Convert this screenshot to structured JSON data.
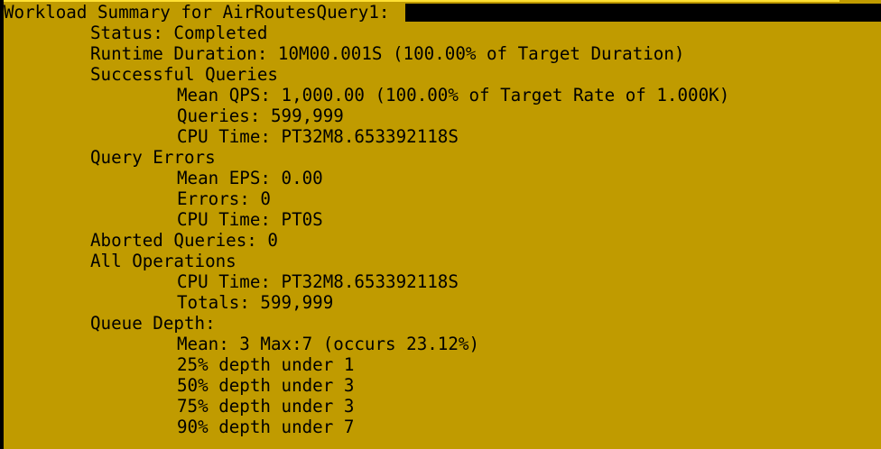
{
  "colors": {
    "background": "#c09b00",
    "text": "#000000",
    "cursor": "#000000",
    "highlight": "#ffe033"
  },
  "summary": {
    "header": "Workload Summary for AirRoutesQuery1:",
    "status": "Status: Completed",
    "runtime": "Runtime Duration: 10M00.001S (100.00% of Target Duration)",
    "successful": {
      "title": "Successful Queries",
      "mean_qps": "Mean QPS: 1,000.00 (100.00% of Target Rate of 1.000K)",
      "queries": "Queries: 599,999",
      "cpu_time": "CPU Time: PT32M8.653392118S"
    },
    "errors": {
      "title": "Query Errors",
      "mean_eps": "Mean EPS: 0.00",
      "errors": "Errors: 0",
      "cpu_time": "CPU Time: PT0S"
    },
    "aborted": "Aborted Queries: 0",
    "all_operations": {
      "title": "All Operations",
      "cpu_time": "CPU Time: PT32M8.653392118S",
      "totals": "Totals: 599,999"
    },
    "queue_depth": {
      "title": "Queue Depth:",
      "mean": "Mean: 3 Max:7 (occurs 23.12%)",
      "p25": "25% depth under 1",
      "p50": "50% depth under 3",
      "p75": "75% depth under 3",
      "p90": "90% depth under 7"
    }
  }
}
